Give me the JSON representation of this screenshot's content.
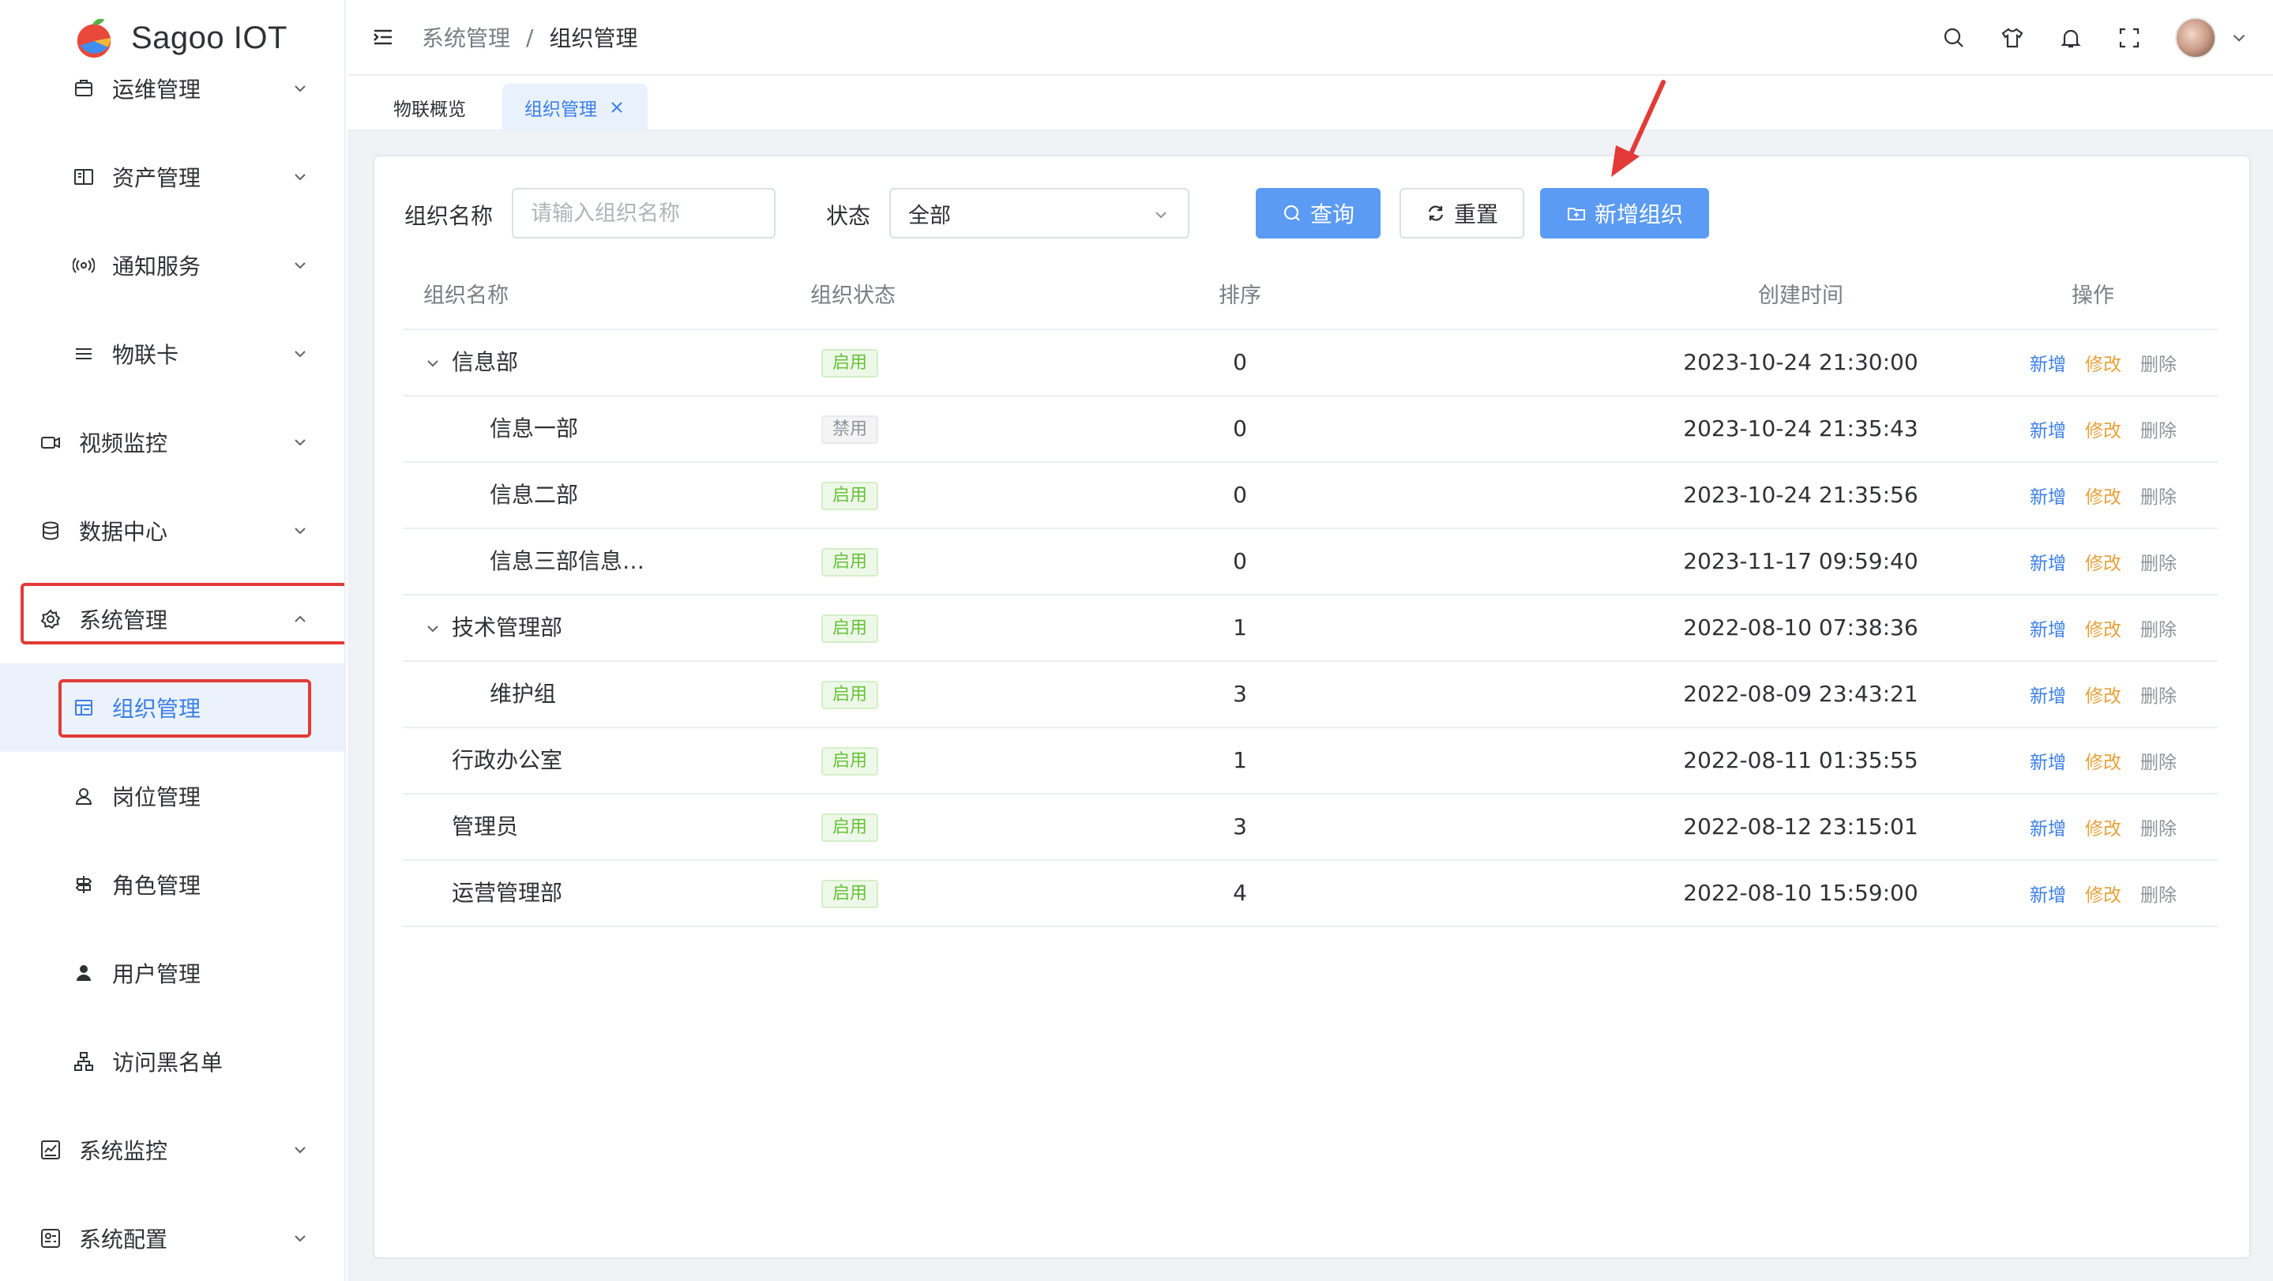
{
  "app": {
    "brand": "Sagoo IOT"
  },
  "sidebar": {
    "items": [
      {
        "label": "运维管理",
        "icon": "box-icon"
      },
      {
        "label": "资产管理",
        "icon": "book-icon"
      },
      {
        "label": "通知服务",
        "icon": "broadcast-icon"
      },
      {
        "label": "物联卡",
        "icon": "lines-icon"
      },
      {
        "label": "视频监控",
        "icon": "camera-icon"
      },
      {
        "label": "数据中心",
        "icon": "database-icon"
      },
      {
        "label": "系统管理",
        "icon": "gear-icon"
      },
      {
        "label": "组织管理",
        "icon": "org-icon"
      },
      {
        "label": "岗位管理",
        "icon": "user-outline-icon"
      },
      {
        "label": "角色管理",
        "icon": "role-icon"
      },
      {
        "label": "用户管理",
        "icon": "user-solid-icon"
      },
      {
        "label": "访问黑名单",
        "icon": "sitemap-icon"
      },
      {
        "label": "系统监控",
        "icon": "monitor-icon"
      },
      {
        "label": "系统配置",
        "icon": "config-icon"
      }
    ]
  },
  "header": {
    "breadcrumb": [
      "系统管理",
      "组织管理"
    ],
    "separator": "/"
  },
  "tabs": [
    {
      "label": "物联概览"
    },
    {
      "label": "组织管理"
    }
  ],
  "search": {
    "name_label": "组织名称",
    "name_placeholder": "请输入组织名称",
    "status_label": "状态",
    "status_value": "全部",
    "query_label": "查询",
    "reset_label": "重置",
    "add_label": "新增组织"
  },
  "table": {
    "headers": [
      "组织名称",
      "组织状态",
      "排序",
      "创建时间",
      "操作"
    ],
    "ops": [
      "新增",
      "修改",
      "删除"
    ],
    "rows": [
      {
        "name": "信息部",
        "status": "启用",
        "sort": "0",
        "time": "2023-10-24 21:30:00"
      },
      {
        "name": "信息一部",
        "status": "禁用",
        "sort": "0",
        "time": "2023-10-24 21:35:43"
      },
      {
        "name": "信息二部",
        "status": "启用",
        "sort": "0",
        "time": "2023-10-24 21:35:56"
      },
      {
        "name": "信息三部信息…",
        "status": "启用",
        "sort": "0",
        "time": "2023-11-17 09:59:40"
      },
      {
        "name": "技术管理部",
        "status": "启用",
        "sort": "1",
        "time": "2022-08-10 07:38:36"
      },
      {
        "name": "维护组",
        "status": "启用",
        "sort": "3",
        "time": "2022-08-09 23:43:21"
      },
      {
        "name": "行政办公室",
        "status": "启用",
        "sort": "1",
        "time": "2022-08-11 01:35:55"
      },
      {
        "name": "管理员",
        "status": "启用",
        "sort": "3",
        "time": "2022-08-12 23:15:01"
      },
      {
        "name": "运营管理部",
        "status": "启用",
        "sort": "4",
        "time": "2022-08-10 15:59:00"
      }
    ]
  },
  "colors": {
    "primary": "#3c7fe8",
    "button_primary": "#5b9bf3",
    "enabled": "#67c23a",
    "disabled": "#909399",
    "edit": "#e6a23c",
    "highlight": "#e23b37"
  }
}
